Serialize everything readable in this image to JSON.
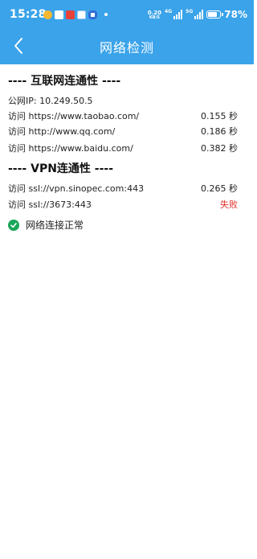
{
  "status_bar": {
    "time": "15:28",
    "net_speed_value": "0.20",
    "net_speed_unit": "KB/S",
    "signal_1_label": "4G",
    "signal_2_label": "5G",
    "battery_level": "78%",
    "battery_fraction": 0.78
  },
  "header": {
    "title": "网络检测",
    "back_icon": "chevron-left-icon",
    "color": "#3aa3ea"
  },
  "internet": {
    "section_title": "---- 互联网连通性 ----",
    "public_ip": "公网IP: 10.249.50.5",
    "rows": [
      {
        "label": "访问 https://www.taobao.com/",
        "value": "0.155 秒"
      },
      {
        "label": "访问 http://www.qq.com/",
        "value": "0.186 秒"
      },
      {
        "label": "访问 https://www.baidu.com/",
        "value": "0.382 秒"
      }
    ]
  },
  "vpn": {
    "section_title": "---- VPN连通性 ----",
    "rows": [
      {
        "label": "访问 ssl://vpn.sinopec.com:443",
        "value": "0.265 秒"
      },
      {
        "label": "访问 ssl://3673:443",
        "value": "失败"
      }
    ]
  },
  "result": {
    "icon": "check-circle-icon",
    "text": "网络连接正常"
  },
  "colors": {
    "fail": "#e0302a",
    "success": "#1aa65a"
  }
}
